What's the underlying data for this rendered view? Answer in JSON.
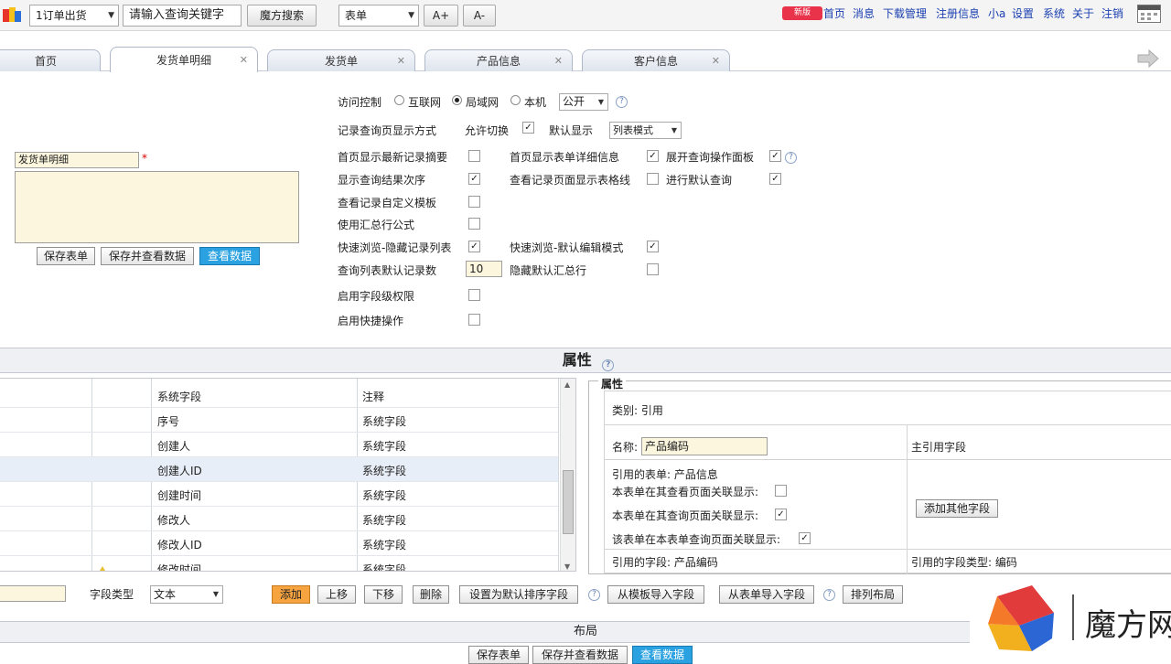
{
  "topbar": {
    "module_select": "1订单出货",
    "search_placeholder": "请输入查询关键字",
    "search_button": "魔方搜索",
    "type_select": "表单",
    "font_plus": "A+",
    "font_minus": "A-",
    "badge": "新版",
    "links": [
      "首页",
      "消息",
      "下载管理",
      "注册信息",
      "小a",
      "设置",
      "系统",
      "关于",
      "注销"
    ]
  },
  "tabs": [
    {
      "label": "首页",
      "closable": false
    },
    {
      "label": "发货单明细",
      "closable": true,
      "active": true
    },
    {
      "label": "发货单",
      "closable": true
    },
    {
      "label": "产品信息",
      "closable": true
    },
    {
      "label": "客户信息",
      "closable": true
    }
  ],
  "form": {
    "title_value": "发货单明细",
    "required_mark": "*",
    "buttons": [
      "保存表单",
      "保存并查看数据",
      "查看数据"
    ]
  },
  "settings": {
    "access_label": "访问控制",
    "access_options": [
      "互联网",
      "局域网",
      "本机"
    ],
    "access_selected": "局域网",
    "access_level": "公开",
    "query_display_label": "记录查询页显示方式",
    "allow_switch_label": "允许切换",
    "default_display_label": "默认显示",
    "default_display_value": "列表模式",
    "left_options": [
      {
        "label": "首页显示最新记录摘要",
        "checked": false
      },
      {
        "label": "显示查询结果次序",
        "checked": true
      },
      {
        "label": "查看记录自定义模板",
        "checked": false
      },
      {
        "label": "使用汇总行公式",
        "checked": false
      },
      {
        "label": "快速浏览-隐藏记录列表",
        "checked": true
      },
      {
        "label": "查询列表默认记录数",
        "value": "10"
      },
      {
        "label": "启用字段级权限",
        "checked": false
      },
      {
        "label": "启用快捷操作",
        "checked": false
      }
    ],
    "mid_options": [
      {
        "label": "首页显示表单详细信息",
        "checked": true
      },
      {
        "label": "查看记录页面显示表格线",
        "checked": false
      },
      {
        "label": "快速浏览-默认编辑模式",
        "checked": true
      },
      {
        "label": "隐藏默认汇总行",
        "checked": false
      }
    ],
    "right_options": [
      {
        "label": "展开查询操作面板",
        "checked": true
      },
      {
        "label": "进行默认查询",
        "checked": true
      }
    ]
  },
  "properties_header": "属性",
  "field_table": {
    "rows": [
      {
        "name": "系统字段",
        "note": "注释"
      },
      {
        "name": "序号",
        "note": "系统字段"
      },
      {
        "name": "创建人",
        "note": "系统字段"
      },
      {
        "name": "创建人ID",
        "note": "系统字段",
        "selected": true
      },
      {
        "name": "创建时间",
        "note": "系统字段"
      },
      {
        "name": "修改人",
        "note": "系统字段"
      },
      {
        "name": "修改人ID",
        "note": "系统字段"
      },
      {
        "name": "修改时间",
        "note": "系统字段"
      }
    ]
  },
  "prop_panel": {
    "legend": "属性",
    "category": "类别: 引用",
    "name_label": "名称:",
    "name_value": "产品编码",
    "main_ref_field": "主引用字段",
    "ref_form": "引用的表单: 产品信息",
    "opt1": {
      "label": "本表单在其查看页面关联显示:",
      "checked": false
    },
    "opt2": {
      "label": "本表单在其查询页面关联显示:",
      "checked": true
    },
    "opt3": {
      "label": "该表单在本表单查询页面关联显示:",
      "checked": true
    },
    "add_other_field": "添加其他字段",
    "ref_field": "引用的字段: 产品编码",
    "ref_field_type": "引用的字段类型: 编码"
  },
  "field_toolbar": {
    "field_type_label": "字段类型",
    "field_type_value": "文本",
    "buttons": [
      "添加",
      "上移",
      "下移",
      "删除",
      "设置为默认排序字段",
      "从模板导入字段",
      "从表单导入字段",
      "排列布局"
    ]
  },
  "layout_header": "布局",
  "bottom_buttons": [
    "保存表单",
    "保存并查看数据",
    "查看数据"
  ],
  "watermark_text": "魔方网"
}
